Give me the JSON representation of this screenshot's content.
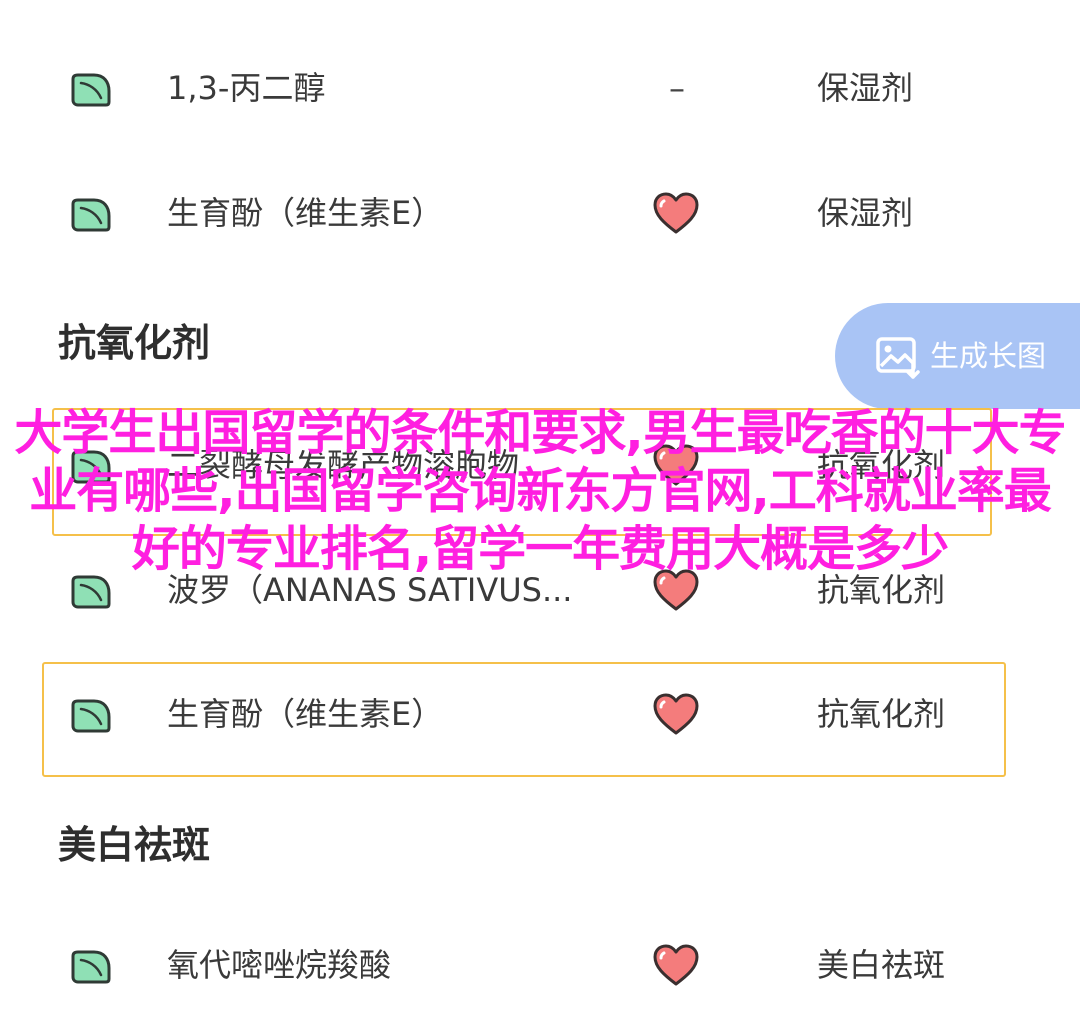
{
  "rows": [
    {
      "name": "1,3-丙二醇",
      "mark": "–",
      "use": "保湿剂"
    },
    {
      "name": "生育酚（维生素E）",
      "use": "保湿剂"
    },
    {
      "name": "二裂酵母发酵产物溶胞物",
      "use": "抗氧化剂"
    },
    {
      "name": "波罗（ANANAS SATIVUS...",
      "use": "抗氧化剂"
    },
    {
      "name": "生育酚（维生素E）",
      "use": "抗氧化剂"
    },
    {
      "name": "氧代嘧唑烷羧酸",
      "use": "美白祛斑"
    }
  ],
  "sections": {
    "antioxidant": "抗氧化剂",
    "whitening": "美白祛斑"
  },
  "generate_button": {
    "label": "生成长图",
    "icon": "image-download-icon"
  },
  "overlay_text": "大学生出国留学的条件和要求,男生最吃香的十大专业有哪些,出国留学咨询新东方官网,工科就业率最好的专业排名,留学一年费用大概是多少",
  "icons": {
    "leaf": "leaf-icon",
    "heart": "heart-icon"
  },
  "colors": {
    "leaf_fill": "#8fe0b5",
    "heart_fill": "#f47c7c",
    "highlight_border": "#f5c04a",
    "button_bg": "#a9c4f5",
    "overlay_text": "#ff1fe0"
  }
}
